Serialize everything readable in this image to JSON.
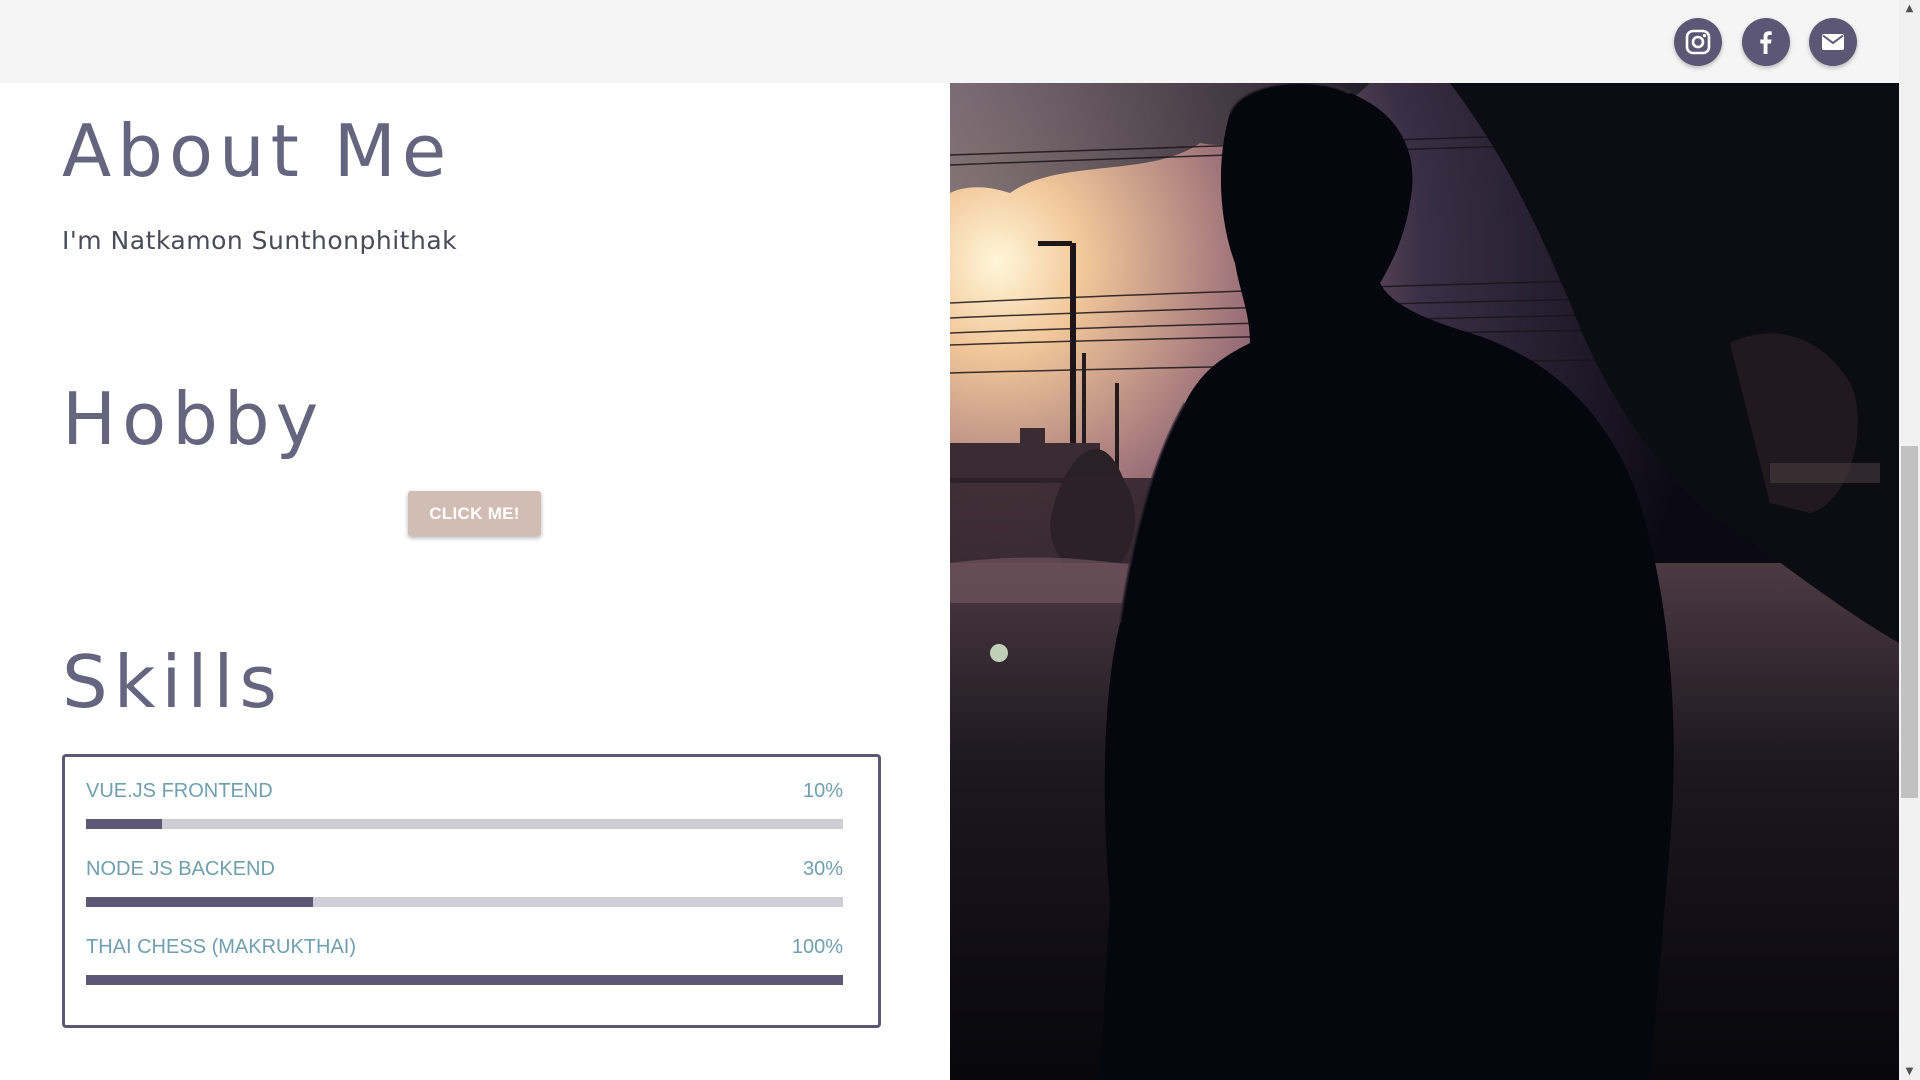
{
  "header": {
    "social_links": [
      {
        "icon": "instagram-icon",
        "label": "Instagram"
      },
      {
        "icon": "facebook-icon",
        "label": "Facebook"
      },
      {
        "icon": "mail-icon",
        "label": "Email"
      }
    ]
  },
  "about": {
    "title": "About Me",
    "intro": "I'm Natkamon Sunthonphithak"
  },
  "hobby": {
    "title": "Hobby",
    "button_label": "CLICK ME!"
  },
  "skills": {
    "title": "Skills",
    "items": [
      {
        "name": "VUE.JS FRONTEND",
        "percent_label": "10%",
        "level": 0.1
      },
      {
        "name": "NODE JS BACKEND",
        "percent_label": "30%",
        "level": 0.3
      },
      {
        "name": "THAI CHESS (MAKRUKTHAI)",
        "percent_label": "100%",
        "level": 1.0
      }
    ]
  },
  "photo": {
    "description_icon": "profile-photo"
  },
  "colors": {
    "accent": "#5b5775",
    "skill_text": "#6f9fb0",
    "button": "#d2bdb5",
    "track": "#cfcdd6",
    "topbar": "#f5f5f5"
  }
}
